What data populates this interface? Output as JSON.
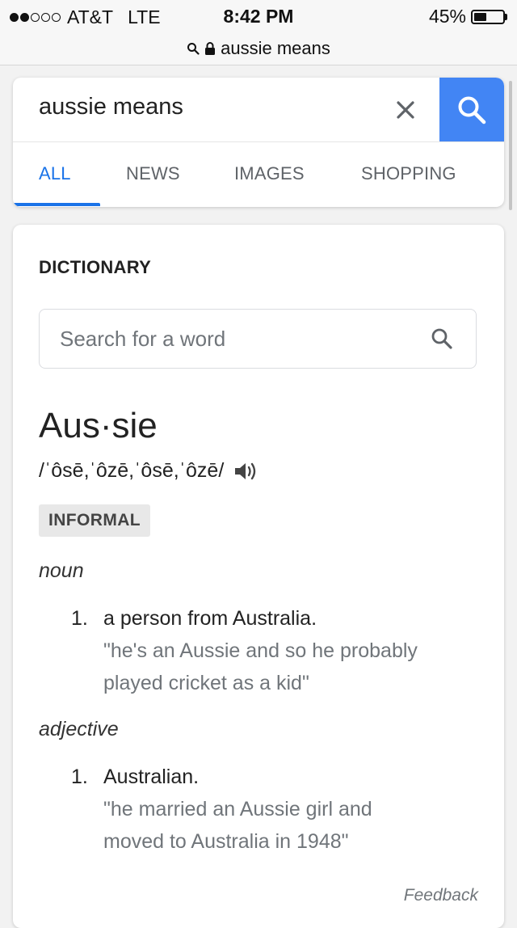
{
  "status_bar": {
    "carrier": "AT&T",
    "network": "LTE",
    "time": "8:42 PM",
    "battery_percent": "45%",
    "battery_level": 0.45,
    "signal_bars_filled": 2,
    "signal_bars_total": 5
  },
  "url_bar": {
    "text": "aussie means"
  },
  "search": {
    "query": "aussie means",
    "tabs": [
      {
        "label": "ALL",
        "active": true
      },
      {
        "label": "NEWS",
        "active": false
      },
      {
        "label": "IMAGES",
        "active": false
      },
      {
        "label": "SHOPPING",
        "active": false
      }
    ],
    "accent_color": "#4285f4"
  },
  "dictionary": {
    "heading": "DICTIONARY",
    "search_placeholder": "Search for a word",
    "headword": "Aus·sie",
    "pronunciation": "/ˈôsē,ˈôzē,ˈôsē,ˈôzē/",
    "label": "INFORMAL",
    "senses": [
      {
        "pos": "noun",
        "number": "1.",
        "definition": "a person from Australia.",
        "example_line1": "\"he's an Aussie and so he probably",
        "example_line2": "played cricket as a kid\""
      },
      {
        "pos": "adjective",
        "number": "1.",
        "definition": "Australian.",
        "example_line1": "\"he married an Aussie girl and",
        "example_line2": "moved to Australia in 1948\""
      }
    ],
    "feedback": "Feedback"
  }
}
